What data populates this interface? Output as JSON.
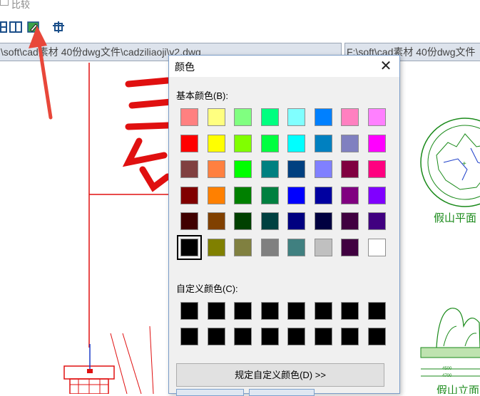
{
  "window": {
    "title": "比较"
  },
  "tabs": [
    {
      "label": ":\\soft\\cad素材 40份dwg文件\\cadziliaoji\\v2.dwg"
    },
    {
      "label": "F:\\soft\\cad素材 40份dwg文件"
    }
  ],
  "drawing": {
    "label_top": "假山平面",
    "label_bottom": "假山立面",
    "dim1": "4500",
    "dim2": "4700"
  },
  "dialog": {
    "title": "颜色",
    "close_label": "✕",
    "basic_label": "基本颜色(B):",
    "custom_label": "自定义颜色(C):",
    "define_button": "规定自定义颜色(D) >>",
    "basic_colors": [
      [
        "#ff8080",
        "#ffff80",
        "#80ff80",
        "#00ff80",
        "#80ffff",
        "#0080ff",
        "#ff80c0",
        "#ff80ff"
      ],
      [
        "#ff0000",
        "#ffff00",
        "#80ff00",
        "#00ff40",
        "#00ffff",
        "#0080c0",
        "#8080c0",
        "#ff00ff"
      ],
      [
        "#804040",
        "#ff8040",
        "#00ff00",
        "#008080",
        "#004080",
        "#8080ff",
        "#800040",
        "#ff0080"
      ],
      [
        "#800000",
        "#ff8000",
        "#008000",
        "#008040",
        "#0000ff",
        "#0000a0",
        "#800080",
        "#8000ff"
      ],
      [
        "#400000",
        "#804000",
        "#004000",
        "#004040",
        "#000080",
        "#000040",
        "#400040",
        "#400080"
      ],
      [
        "#000000",
        "#808000",
        "#808040",
        "#808080",
        "#408080",
        "#c0c0c0",
        "#400040",
        "#ffffff"
      ]
    ],
    "selected_color": "#000000",
    "custom_colors": [
      "#000000",
      "#000000",
      "#000000",
      "#000000",
      "#000000",
      "#000000",
      "#000000",
      "#000000",
      "#000000",
      "#000000",
      "#000000",
      "#000000",
      "#000000",
      "#000000",
      "#000000",
      "#000000"
    ],
    "accent": "#7a9cc8"
  },
  "annotation": {
    "arrow_color": "#e8473a"
  }
}
